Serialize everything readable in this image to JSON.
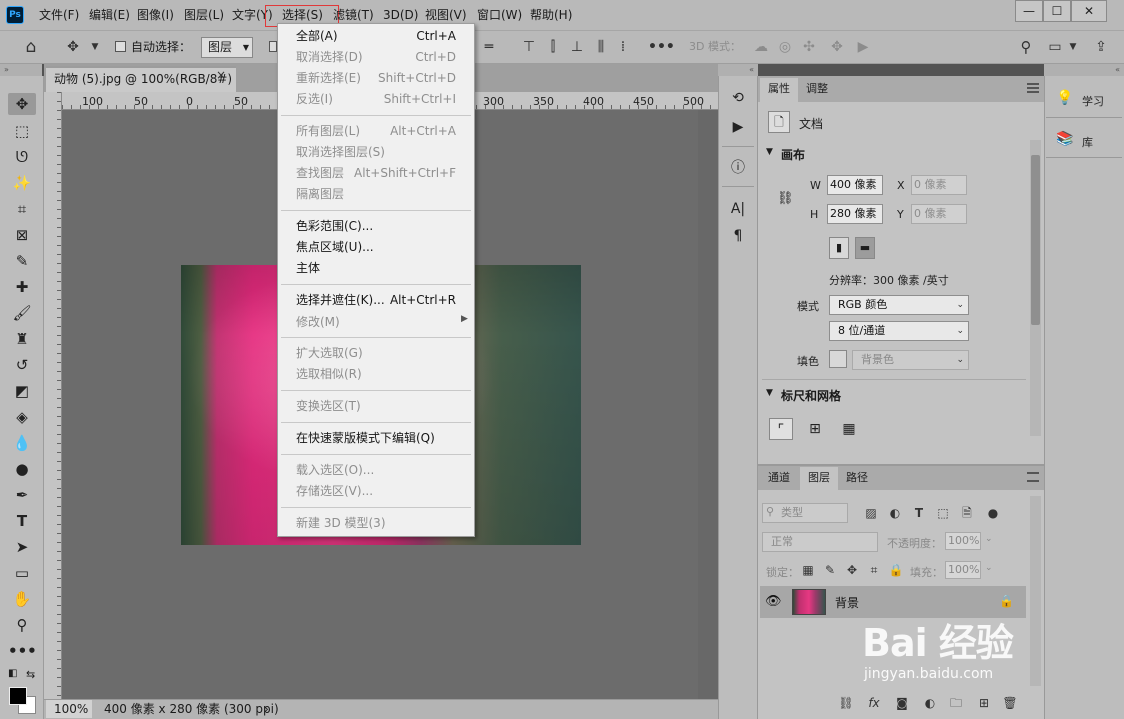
{
  "app": {
    "logo": "Ps",
    "window_controls": [
      "—",
      "☐",
      "✕"
    ]
  },
  "menubar": {
    "items": [
      "文件(F)",
      "编辑(E)",
      "图像(I)",
      "图层(L)",
      "文字(Y)",
      "选择(S)",
      "滤镜(T)",
      "3D(D)",
      "视图(V)",
      "窗口(W)",
      "帮助(H)"
    ],
    "active": "选择(S)",
    "highlight_color": "#e0393a"
  },
  "options_bar": {
    "auto_select_label": "自动选择：",
    "auto_select_target": "图层",
    "mode_3d_label": "3D 模式："
  },
  "document": {
    "tab_title": "动物 (5).jpg @ 100%(RGB/8#)",
    "tab_close": "×",
    "ruler_labels": [
      "100",
      "50",
      "0",
      "50",
      "300",
      "350",
      "400",
      "450",
      "500"
    ],
    "zoom": "100%",
    "size_info": "400 像素 x 280 像素 (300 ppi)",
    "status_arrow": "›"
  },
  "select_menu": {
    "items": [
      {
        "label": "全部(A)",
        "shortcut": "Ctrl+A",
        "enabled": true
      },
      {
        "label": "取消选择(D)",
        "shortcut": "Ctrl+D",
        "enabled": false
      },
      {
        "label": "重新选择(E)",
        "shortcut": "Shift+Ctrl+D",
        "enabled": false
      },
      {
        "label": "反选(I)",
        "shortcut": "Shift+Ctrl+I",
        "enabled": false
      },
      {
        "label": "所有图层(L)",
        "shortcut": "Alt+Ctrl+A",
        "enabled": false
      },
      {
        "label": "取消选择图层(S)",
        "shortcut": "",
        "enabled": false
      },
      {
        "label": "查找图层",
        "shortcut": "Alt+Shift+Ctrl+F",
        "enabled": false
      },
      {
        "label": "隔离图层",
        "shortcut": "",
        "enabled": false
      },
      {
        "label": "色彩范围(C)...",
        "shortcut": "",
        "enabled": true
      },
      {
        "label": "焦点区域(U)...",
        "shortcut": "",
        "enabled": true
      },
      {
        "label": "主体",
        "shortcut": "",
        "enabled": true
      },
      {
        "label": "选择并遮住(K)...",
        "shortcut": "Alt+Ctrl+R",
        "enabled": true
      },
      {
        "label": "修改(M)",
        "shortcut": "",
        "enabled": false
      },
      {
        "label": "扩大选取(G)",
        "shortcut": "",
        "enabled": false
      },
      {
        "label": "选取相似(R)",
        "shortcut": "",
        "enabled": false
      },
      {
        "label": "变换选区(T)",
        "shortcut": "",
        "enabled": false
      },
      {
        "label": "在快速蒙版模式下编辑(Q)",
        "shortcut": "",
        "enabled": true
      },
      {
        "label": "载入选区(O)...",
        "shortcut": "",
        "enabled": false
      },
      {
        "label": "存储选区(V)...",
        "shortcut": "",
        "enabled": false
      },
      {
        "label": "新建 3D 模型(3)",
        "shortcut": "",
        "enabled": false
      }
    ]
  },
  "properties": {
    "tabs": [
      "属性",
      "调整"
    ],
    "doc_label": "文档",
    "canvas_section": "画布",
    "w_label": "W",
    "w_value": "400 像素",
    "h_label": "H",
    "h_value": "280 像素",
    "x_label": "X",
    "x_placeholder": "0 像素",
    "y_label": "Y",
    "y_placeholder": "0 像素",
    "resolution": "分辨率：300 像素 /英寸",
    "mode_label": "模式",
    "mode_value": "RGB 颜色",
    "bit_value": "8 位/通道",
    "fill_label": "填色",
    "fill_value": "背景色",
    "rulers_section": "标尺和网格"
  },
  "layers": {
    "tabs": [
      "通道",
      "图层",
      "路径"
    ],
    "filter_kind": "类型",
    "blend_mode": "正常",
    "opacity_label": "不透明度：",
    "opacity_value": "100%",
    "lock_label": "锁定：",
    "fill_label": "填充：",
    "fill_value": "100%",
    "items": [
      {
        "name": "背景",
        "visible": true,
        "locked": true
      }
    ]
  },
  "right_column": {
    "learn": "学习",
    "library": "库"
  },
  "watermark": {
    "brand": "Bai 经验",
    "site": "jingyan.baidu.com"
  }
}
